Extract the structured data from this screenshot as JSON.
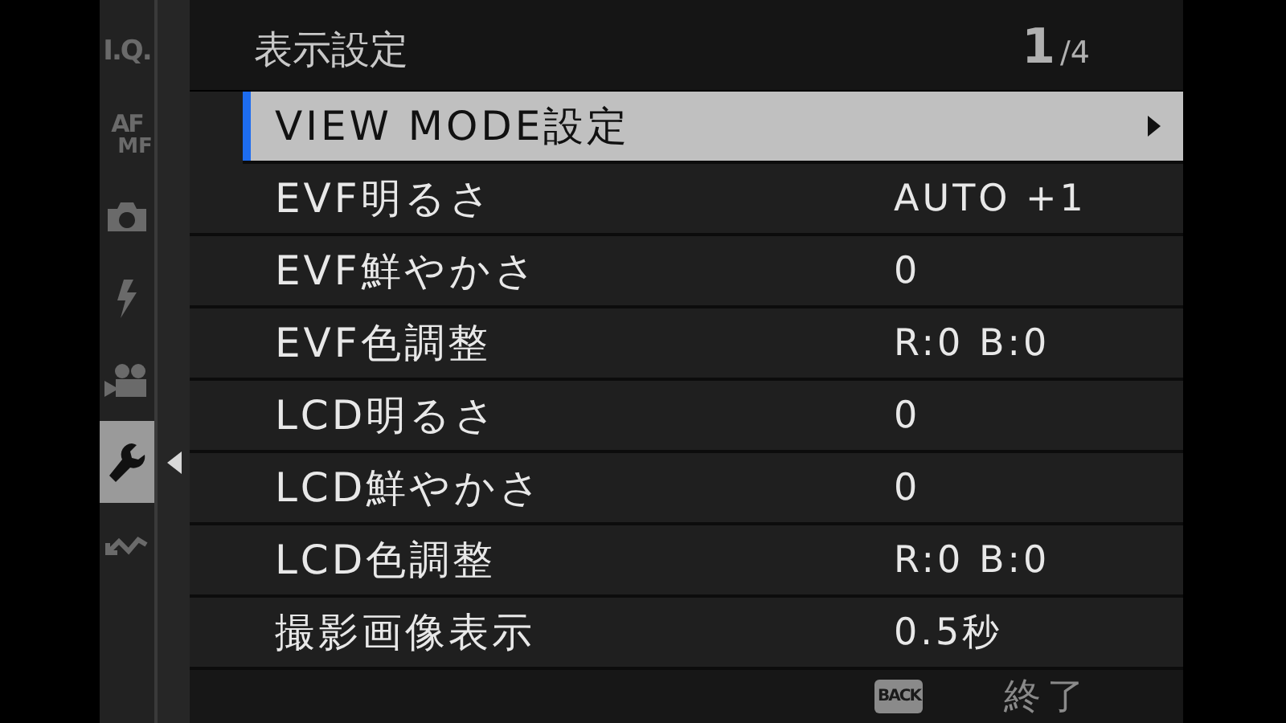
{
  "header": {
    "title": "表示設定",
    "page": "1",
    "page_total": "/4"
  },
  "sidebar": {
    "tabs": [
      {
        "kind": "text",
        "lines": [
          "I.Q."
        ],
        "selected": false
      },
      {
        "kind": "text",
        "lines": [
          "AF",
          "MF"
        ],
        "selected": false
      },
      {
        "kind": "camera",
        "selected": false
      },
      {
        "kind": "flash",
        "selected": false
      },
      {
        "kind": "movie",
        "selected": false
      },
      {
        "kind": "wrench",
        "selected": true
      },
      {
        "kind": "wave",
        "selected": false
      }
    ]
  },
  "menu": {
    "rows": [
      {
        "label": "VIEW MODE設定",
        "selected": true,
        "submenu": true
      },
      {
        "label": "EVF明るさ",
        "value": "AUTO +1",
        "selected": false,
        "submenu": false
      },
      {
        "label": "EVF鮮やかさ",
        "value": "0",
        "selected": false,
        "submenu": false
      },
      {
        "label": "EVF色調整",
        "value": "R:0 B:0",
        "selected": false,
        "submenu": false
      },
      {
        "label": "LCD明るさ",
        "value": "0",
        "selected": false,
        "submenu": false
      },
      {
        "label": "LCD鮮やかさ",
        "value": "0",
        "selected": false,
        "submenu": false
      },
      {
        "label": "LCD色調整",
        "value": "R:0 B:0",
        "selected": false,
        "submenu": false
      },
      {
        "label": "撮影画像表示",
        "value": "0.5秒",
        "selected": false,
        "submenu": false
      }
    ]
  },
  "footer": {
    "key": "BACK",
    "label": "終了"
  }
}
